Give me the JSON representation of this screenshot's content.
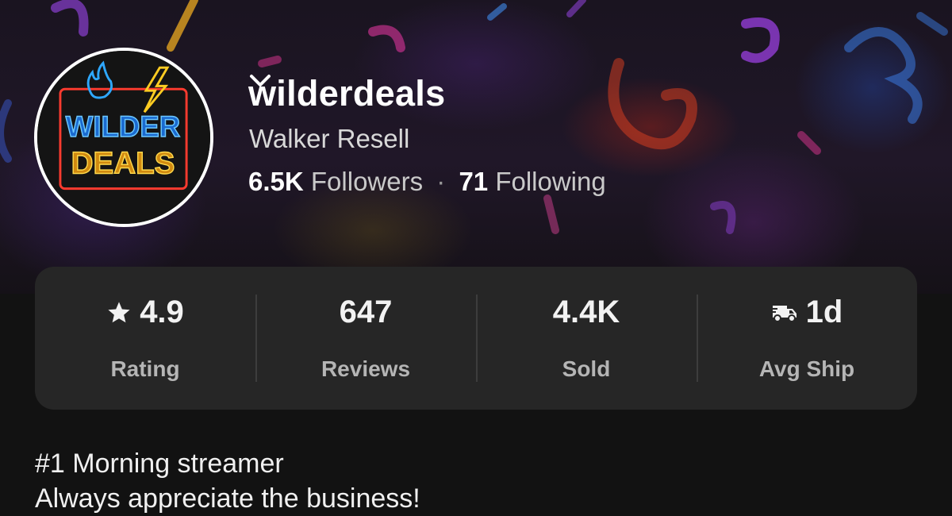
{
  "profile": {
    "username": "wilderdeals",
    "display_name": "Walker Resell",
    "followers_count": "6.5K",
    "followers_label": "Followers",
    "separator": "·",
    "following_count": "71",
    "following_label": "Following",
    "avatar_logo": "WILDER DEALS"
  },
  "stats": [
    {
      "value": "4.9",
      "label": "Rating",
      "icon": "star-icon"
    },
    {
      "value": "647",
      "label": "Reviews"
    },
    {
      "value": "4.4K",
      "label": "Sold"
    },
    {
      "value": "1d",
      "label": "Avg Ship",
      "icon": "shipping-truck-icon"
    }
  ],
  "bio": {
    "line1": "#1 Morning streamer",
    "line2": "Always appreciate the business!"
  },
  "colors": {
    "background": "#121212",
    "card": "#262626",
    "neon_blue": "#2ea8ff",
    "neon_yellow": "#ffcc22",
    "neon_red": "#ff3b2f"
  }
}
